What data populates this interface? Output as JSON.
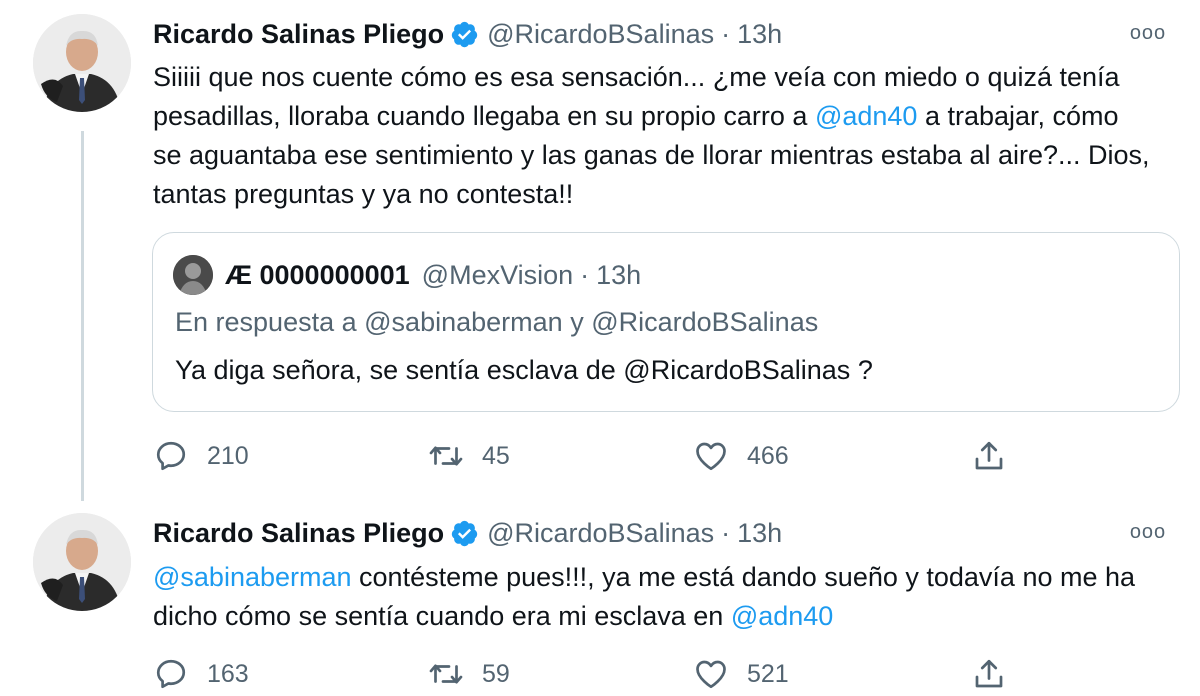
{
  "tweets": [
    {
      "author_name": "Ricardo Salinas Pliego",
      "handle": "@RicardoBSalinas",
      "separator": "·",
      "time": "13h",
      "more_icon": "ooo",
      "text_before": "Siiiii que nos cuente cómo es esa sensación... ¿me veía con miedo o quizá tenía pesadillas, lloraba cuando llegaba en su propio carro a ",
      "mention_1": "@adn40",
      "text_after": " a trabajar, cómo se aguantaba ese sentimiento y las ganas de llorar mientras estaba al aire?... Dios, tantas preguntas y ya no contesta!!",
      "quote": {
        "author_name": "Æ 0000000001",
        "handle": "@MexVision",
        "separator": "·",
        "time": "13h",
        "reply_prefix": "En respuesta a",
        "reply_mention_1": "@sabinaberman",
        "reply_and": "y",
        "reply_mention_2": "@RicardoBSalinas",
        "text_before": "Ya diga señora, se sentía esclava de ",
        "text_mention": "@RicardoBSalinas",
        "text_after": " ?"
      },
      "stats": {
        "replies": "210",
        "retweets": "45",
        "likes": "466"
      }
    },
    {
      "author_name": "Ricardo Salinas Pliego",
      "handle": "@RicardoBSalinas",
      "separator": "·",
      "time": "13h",
      "more_icon": "ooo",
      "mention_1": "@sabinaberman",
      "text_middle": " contésteme pues!!!, ya me está dando sueño y todavía no me ha dicho cómo se sentía cuando era mi esclava en ",
      "mention_2": "@adn40",
      "stats": {
        "replies": "163",
        "retweets": "59",
        "likes": "521"
      }
    }
  ],
  "icons": {
    "reply": "reply-icon",
    "retweet": "retweet-icon",
    "like": "like-icon",
    "share": "share-icon",
    "verified": "verified-badge-icon"
  },
  "colors": {
    "link": "#1d9bf0",
    "secondary": "#536471",
    "verified": "#1d9bf0",
    "border": "#cfd9de"
  }
}
